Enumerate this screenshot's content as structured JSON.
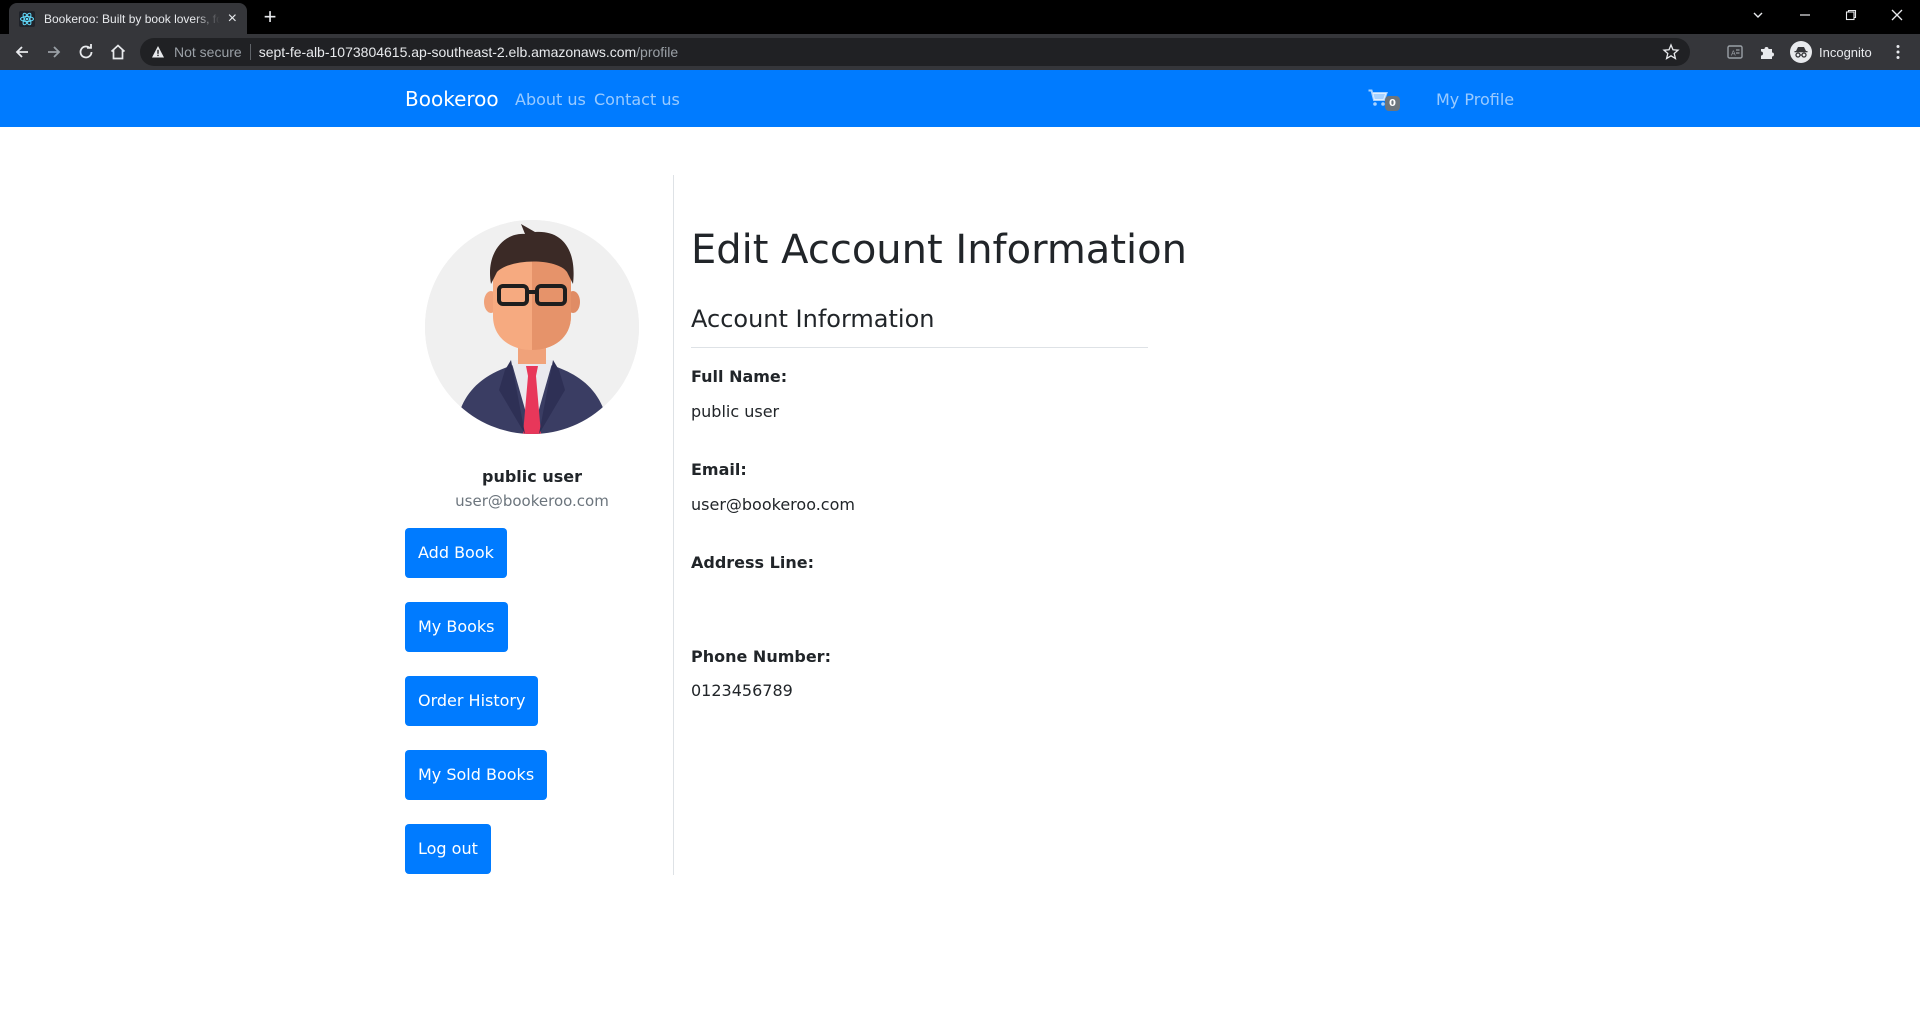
{
  "browser": {
    "tab_title": "Bookeroo: Built by book lovers, for book lovers",
    "not_secure_label": "Not secure",
    "url_host": "sept-fe-alb-1073804615.ap-southeast-2.elb.amazonaws.com",
    "url_path": "/profile",
    "profile_label": "Incognito"
  },
  "navbar": {
    "brand": "Bookeroo",
    "links": [
      "About us",
      "Contact us"
    ],
    "cart_count": "0",
    "profile_link": "My Profile",
    "color": "#007bff"
  },
  "sidebar": {
    "name": "public user",
    "email": "user@bookeroo.com",
    "buttons": [
      "Add Book",
      "My Books",
      "Order History",
      "My Sold Books",
      "Log out"
    ]
  },
  "main": {
    "title": "Edit Account Information",
    "section_title": "Account Information",
    "fields": [
      {
        "label": "Full Name:",
        "value": "public user"
      },
      {
        "label": "Email:",
        "value": "user@bookeroo.com"
      },
      {
        "label": "Address Line:",
        "value": ""
      },
      {
        "label": "Phone Number:",
        "value": "0123456789"
      }
    ]
  }
}
